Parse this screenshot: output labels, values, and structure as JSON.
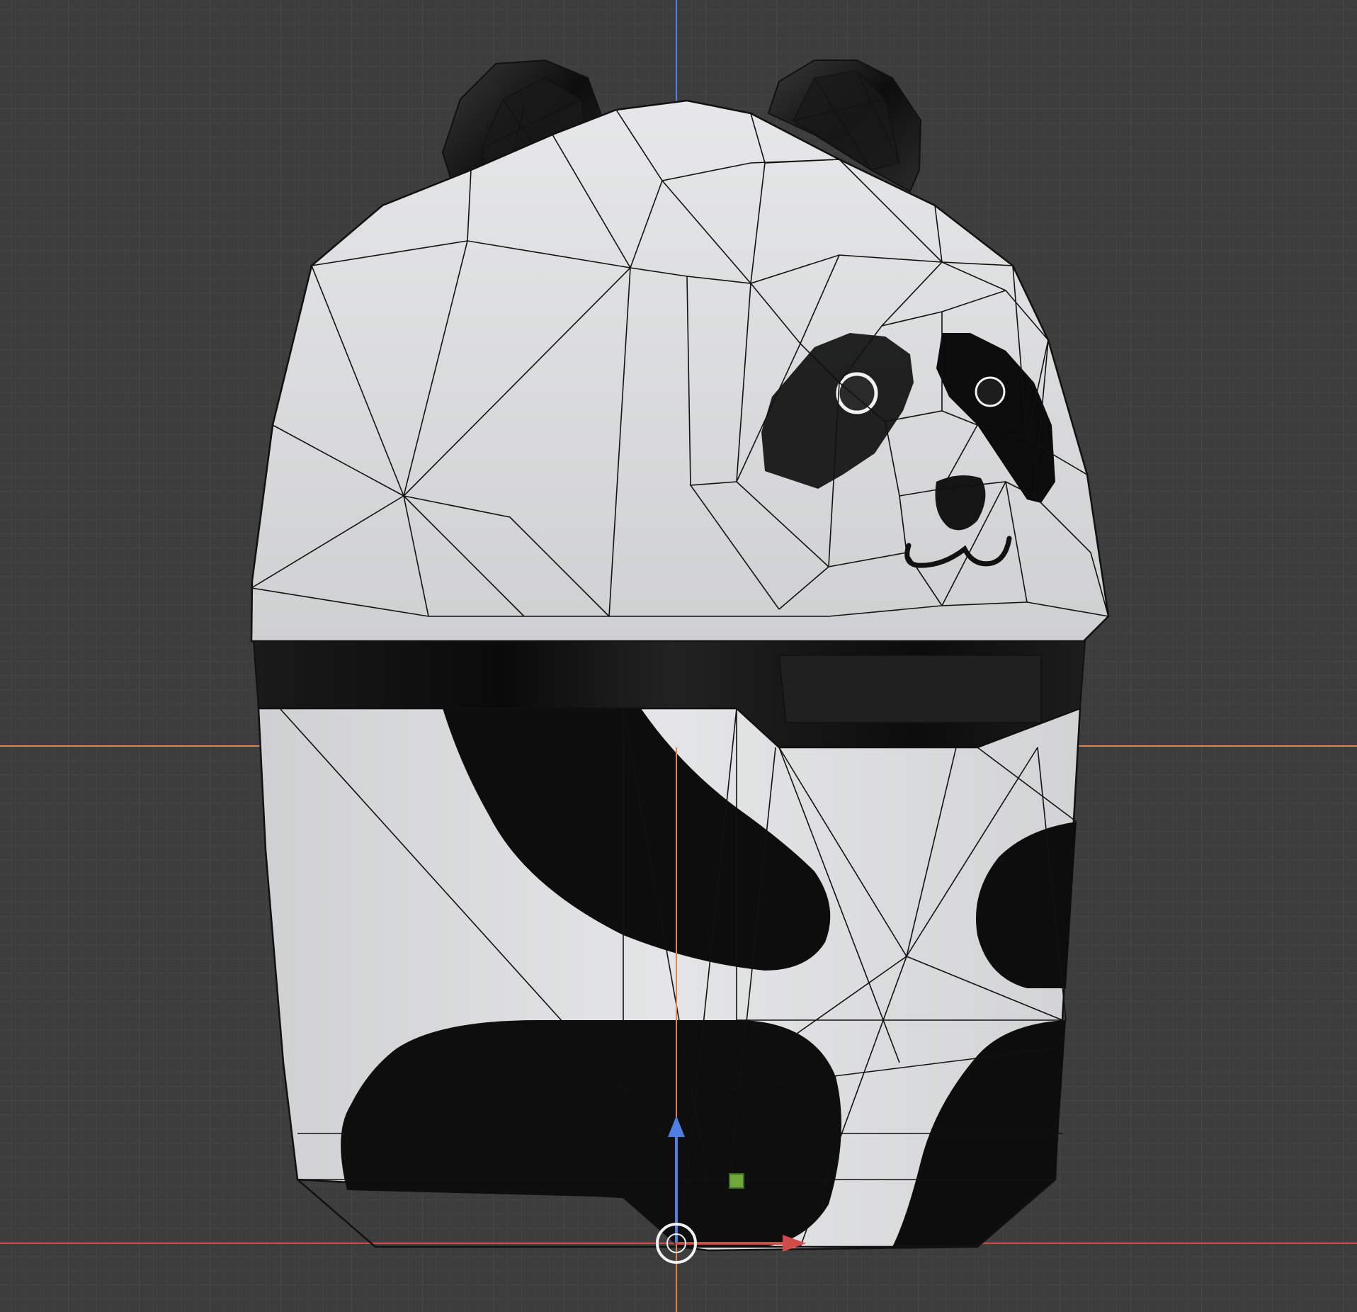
{
  "viewport": {
    "background_color": "#3d3d3d",
    "grid_color": "#464646"
  },
  "axes": {
    "x_axis_color": "#d24b4b",
    "y_axis_color": "#4f7fe0",
    "horizon_line_color": "#e0834f",
    "vertical_line_color": "#e0834f"
  },
  "model": {
    "name": "panda",
    "body_white": "#d9dadb",
    "body_black": "#0f0f0f",
    "wire_color": "#111111"
  },
  "gizmo": {
    "origin_icon": "origin-circle-icon",
    "translate_z": "arrow-up-icon",
    "translate_x": "arrow-right-icon",
    "plane_handle": "plane-handle-icon",
    "z_color": "#4f7fe0",
    "x_color": "#d24b4b",
    "plane_color": "#6fa83a"
  }
}
